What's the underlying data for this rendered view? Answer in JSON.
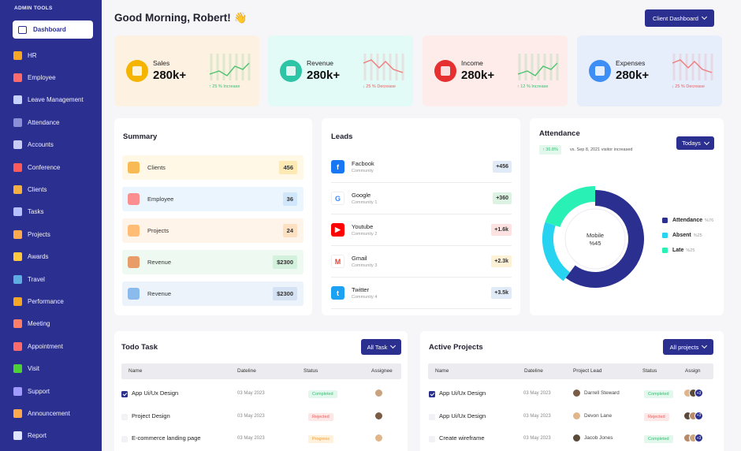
{
  "sidebar": {
    "heading": "ADMIN TOOLS",
    "active_item": {
      "label": "Dashboard",
      "icon": "monitor-icon"
    },
    "items": [
      {
        "label": "HR",
        "icon": "hr-icon",
        "color": "#f5a623"
      },
      {
        "label": "Employee",
        "icon": "employee-icon",
        "color": "#ff6b6b"
      },
      {
        "label": "Leave Management",
        "icon": "leave-icon",
        "color": "#c8d2ff"
      },
      {
        "label": "Attendance",
        "icon": "attendance-icon",
        "color": "#8a8fd8"
      },
      {
        "label": "Accounts",
        "icon": "accounts-icon",
        "color": "#c9cdf5"
      },
      {
        "label": "Conference",
        "icon": "conference-icon",
        "color": "#ff5a5a"
      },
      {
        "label": "Clients",
        "icon": "clients-icon",
        "color": "#f5b041"
      },
      {
        "label": "Tasks",
        "icon": "tasks-icon",
        "color": "#b7c0ff"
      },
      {
        "label": "Projects",
        "icon": "projects-icon",
        "color": "#ffa94d"
      },
      {
        "label": "Awards",
        "icon": "awards-icon",
        "color": "#ffc83d"
      },
      {
        "label": "Travel",
        "icon": "travel-icon",
        "color": "#5dade2"
      },
      {
        "label": "Performance",
        "icon": "performance-icon",
        "color": "#f5a623"
      },
      {
        "label": "Meeting",
        "icon": "meeting-icon",
        "color": "#ff7e67"
      },
      {
        "label": "Appointment",
        "icon": "appointment-icon",
        "color": "#ff6b6b"
      },
      {
        "label": "Visit",
        "icon": "visit-icon",
        "color": "#4cd137"
      },
      {
        "label": "Support",
        "icon": "support-icon",
        "color": "#a29bfe"
      },
      {
        "label": "Announcement",
        "icon": "announcement-icon",
        "color": "#ffa94d"
      },
      {
        "label": "Report",
        "icon": "report-icon",
        "color": "#dfe4ff"
      }
    ]
  },
  "header": {
    "greeting": "Good Morning, Robert!",
    "wave": "👋",
    "dashboard_button": "Client Dashboard"
  },
  "stats": [
    {
      "label": "Sales",
      "value": "280k+",
      "trend": "↑ 25 % Increase",
      "trend_color": "#2fbf71",
      "bg": "#fdf1e1",
      "circle": "#f5b400",
      "line": "#4cc36f",
      "icon": "chart-icon"
    },
    {
      "label": "Revenue",
      "value": "280k+",
      "trend": "↓ 25 % Decrease",
      "trend_color": "#ef5a5a",
      "bg": "#e3fbf7",
      "circle": "#2ec4a6",
      "line": "#ef7c7c",
      "icon": "money-bag-icon"
    },
    {
      "label": "Income",
      "value": "280k+",
      "trend": "↑ 12 % Increase",
      "trend_color": "#2fbf71",
      "bg": "#fdecea",
      "circle": "#e5302f",
      "line": "#4cc36f",
      "icon": "wallet-icon"
    },
    {
      "label": "Expenses",
      "value": "280k+",
      "trend": "↓ 25 % Decrease",
      "trend_color": "#ef5a5a",
      "bg": "#e6eefc",
      "circle": "#3d8ef5",
      "line": "#ef7c7c",
      "icon": "coins-icon"
    }
  ],
  "summary": {
    "title": "Summary",
    "rows": [
      {
        "label": "Clients",
        "value": "456",
        "bg": "#fff8e7",
        "pill": "#fde9b4",
        "icon": "clients-icon",
        "icon_color": "#f5a623"
      },
      {
        "label": "Employee",
        "value": "36",
        "bg": "#eaf5fd",
        "pill": "#cfe6fb",
        "icon": "employee-icon",
        "icon_color": "#ff6b6b"
      },
      {
        "label": "Projects",
        "value": "24",
        "bg": "#fff4ea",
        "pill": "#fde0c2",
        "icon": "projects-icon",
        "icon_color": "#ffa94d"
      },
      {
        "label": "Revenue",
        "value": "$2300",
        "bg": "#eefaf1",
        "pill": "#d3f1dc",
        "icon": "revenue-icon",
        "icon_color": "#e57c3a"
      },
      {
        "label": "Revenue",
        "value": "$2300",
        "bg": "#edf3fb",
        "pill": "#d5e2f3",
        "icon": "revenue-icon",
        "icon_color": "#6aa7e8"
      }
    ]
  },
  "leads": {
    "title": "Leads",
    "rows": [
      {
        "name": "Facbook",
        "sub": "Community",
        "value": "+456",
        "pill": "#e1ebf8",
        "icon": "facebook-icon",
        "glyph": "f",
        "icon_bg": "#1877f2",
        "icon_fg": "#fff"
      },
      {
        "name": "Google",
        "sub": "Community 1",
        "value": "+360",
        "pill": "#dcf3e3",
        "icon": "google-icon",
        "glyph": "G",
        "icon_bg": "#fff",
        "icon_fg": "#4285f4"
      },
      {
        "name": "Youtube",
        "sub": "Community 2",
        "value": "+1.6k",
        "pill": "#fde2e1",
        "icon": "youtube-icon",
        "glyph": "▶",
        "icon_bg": "#ff0000",
        "icon_fg": "#fff"
      },
      {
        "name": "Gmail",
        "sub": "Community 3",
        "value": "+2.3k",
        "pill": "#fdf1d6",
        "icon": "gmail-icon",
        "glyph": "M",
        "icon_bg": "#fff",
        "icon_fg": "#ea4335"
      },
      {
        "name": "Twitter",
        "sub": "Community 4",
        "value": "+3.5k",
        "pill": "#e1ebf8",
        "icon": "twitter-icon",
        "glyph": "t",
        "icon_bg": "#1da1f2",
        "icon_fg": "#fff"
      }
    ]
  },
  "attendance": {
    "title": "Attendance",
    "filter": "Todays",
    "badge": "↑ 36.8%",
    "note": "vs. Sep 8, 2021 visitor increased",
    "center_label": "Mobile",
    "center_value": "%45",
    "legend": [
      {
        "label": "Attendance",
        "pct": "%76",
        "color": "#2b2f8f"
      },
      {
        "label": "Absent",
        "pct": "%25",
        "color": "#27d3f0"
      },
      {
        "label": "Late",
        "pct": "%25",
        "color": "#29f0b4"
      }
    ]
  },
  "chart_data": {
    "type": "pie",
    "categories": [
      "Attendance",
      "Absent",
      "Late"
    ],
    "values": [
      76,
      25,
      25
    ],
    "colors": [
      "#2b2f8f",
      "#27d3f0",
      "#29f0b4"
    ],
    "center_label": "Mobile %45"
  },
  "todo": {
    "title": "Todo Task",
    "filter": "All Task",
    "columns": [
      "Name",
      "Dateline",
      "Status",
      "Assignee"
    ],
    "rows": [
      {
        "name": "App Ui/Ux Design",
        "date": "03 May 2023",
        "status": "Completed",
        "checked": true
      },
      {
        "name": "Project Design",
        "date": "03 May 2023",
        "status": "Rejected",
        "checked": false
      },
      {
        "name": "E-commerce landing page",
        "date": "03 May 2023",
        "status": "Progress",
        "checked": false
      }
    ]
  },
  "projects": {
    "title": "Active Projects",
    "filter": "All projects",
    "columns": [
      "Name",
      "Dateline",
      "Project Lead",
      "Status",
      "Assign"
    ],
    "rows": [
      {
        "name": "App Ui/Ux Design",
        "date": "03 May 2023",
        "lead": "Darrell Steward",
        "status": "Completed",
        "checked": true,
        "more": "+3"
      },
      {
        "name": "App Ui/Ux Design",
        "date": "03 May 2023",
        "lead": "Devon Lane",
        "status": "Rejected",
        "checked": false,
        "more": "+3"
      },
      {
        "name": "Create wireframe",
        "date": "03 May 2023",
        "lead": "Jacob Jones",
        "status": "Completed",
        "checked": false,
        "more": "+3"
      }
    ]
  },
  "status_colors": {
    "Completed": {
      "bg": "#e3f8ec",
      "fg": "#2fbf71"
    },
    "Rejected": {
      "bg": "#fde7e7",
      "fg": "#ef5a5a"
    },
    "Progress": {
      "bg": "#fff1dc",
      "fg": "#f39c34"
    }
  }
}
